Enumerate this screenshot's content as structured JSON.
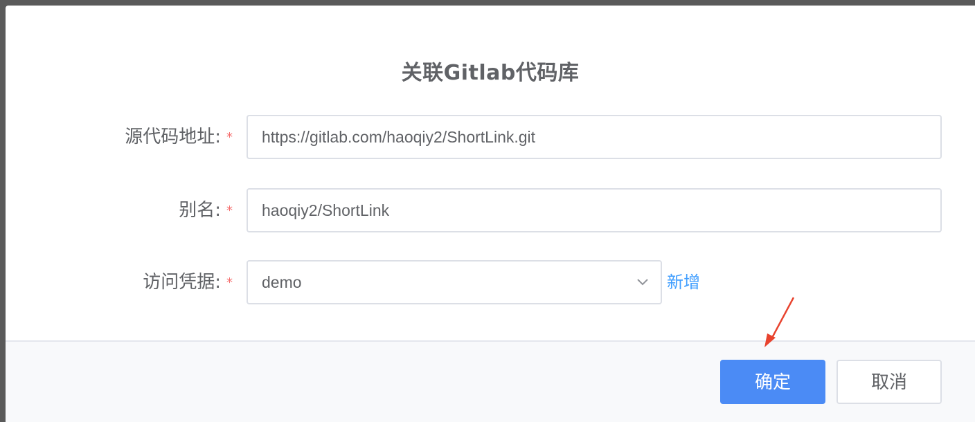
{
  "dialog": {
    "title": "关联Gitlab代码库"
  },
  "form": {
    "source_url": {
      "label": "源代码地址:",
      "required_mark": "*",
      "value": "https://gitlab.com/haoqiy2/ShortLink.git"
    },
    "alias": {
      "label": "别名:",
      "required_mark": "*",
      "value": "haoqiy2/ShortLink"
    },
    "credential": {
      "label": "访问凭据:",
      "required_mark": "*",
      "selected": "demo",
      "add_link": "新增"
    }
  },
  "footer": {
    "confirm_label": "确定",
    "cancel_label": "取消"
  },
  "colors": {
    "primary": "#4b8bf5",
    "link": "#409eff",
    "required": "#f56c6c",
    "annotation_arrow": "#e8432e"
  },
  "icons": {
    "select_indicator": "chevron-down-icon",
    "annotation": "red-arrow-annotation"
  }
}
